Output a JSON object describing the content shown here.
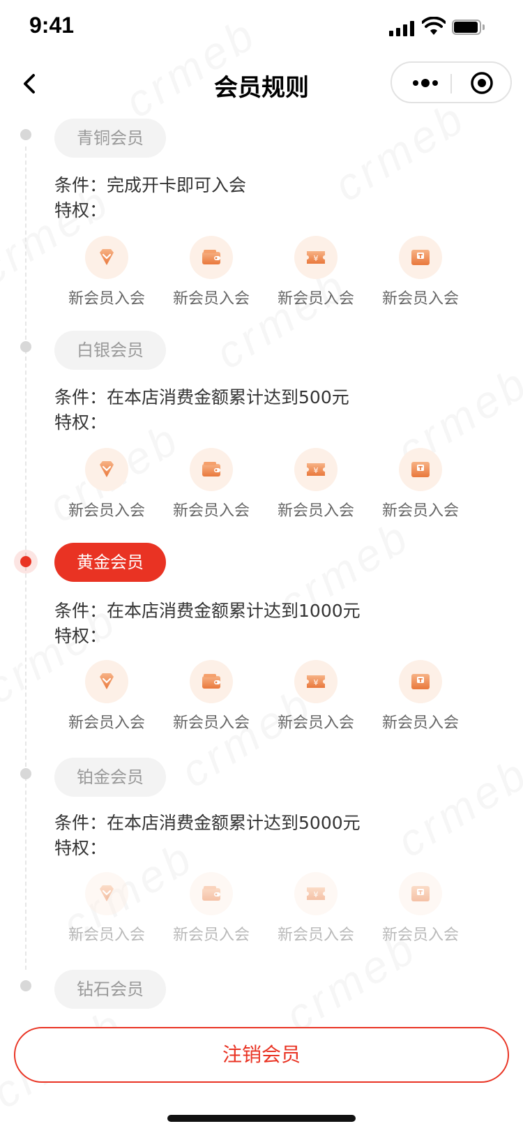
{
  "status_bar": {
    "time": "9:41"
  },
  "nav": {
    "title": "会员规则",
    "back_icon": "chevron-left-icon",
    "more_icon": "more-dots-icon",
    "close_icon": "target-circle-icon"
  },
  "levels": [
    {
      "name": "青铜会员",
      "active": false,
      "condition": "条件：完成开卡即可入会",
      "privilege_label": "特权：",
      "benefits": [
        {
          "label": "新会员入会",
          "icon": "diamond-icon"
        },
        {
          "label": "新会员入会",
          "icon": "wallet-icon"
        },
        {
          "label": "新会员入会",
          "icon": "coupon-icon"
        },
        {
          "label": "新会员入会",
          "icon": "gift-card-icon"
        }
      ]
    },
    {
      "name": "白银会员",
      "active": false,
      "condition": "条件：在本店消费金额累计达到500元",
      "privilege_label": "特权：",
      "benefits": [
        {
          "label": "新会员入会",
          "icon": "diamond-icon"
        },
        {
          "label": "新会员入会",
          "icon": "wallet-icon"
        },
        {
          "label": "新会员入会",
          "icon": "coupon-icon"
        },
        {
          "label": "新会员入会",
          "icon": "gift-card-icon"
        }
      ]
    },
    {
      "name": "黄金会员",
      "active": true,
      "condition": "条件：在本店消费金额累计达到1000元",
      "privilege_label": "特权：",
      "benefits": [
        {
          "label": "新会员入会",
          "icon": "diamond-icon"
        },
        {
          "label": "新会员入会",
          "icon": "wallet-icon"
        },
        {
          "label": "新会员入会",
          "icon": "coupon-icon"
        },
        {
          "label": "新会员入会",
          "icon": "gift-card-icon"
        }
      ]
    },
    {
      "name": "铂金会员",
      "active": false,
      "condition": "条件：在本店消费金额累计达到5000元",
      "privilege_label": "特权：",
      "benefits": [
        {
          "label": "新会员入会",
          "icon": "diamond-icon"
        },
        {
          "label": "新会员入会",
          "icon": "wallet-icon"
        },
        {
          "label": "新会员入会",
          "icon": "coupon-icon"
        },
        {
          "label": "新会员入会",
          "icon": "gift-card-icon"
        }
      ]
    },
    {
      "name": "钻石会员",
      "active": false
    }
  ],
  "footer": {
    "cancel_label": "注销会员"
  },
  "colors": {
    "accent": "#e93323",
    "icon_bg": "#fdf0e7",
    "icon_gradient_start": "#f7b285",
    "icon_gradient_end": "#e9783c"
  }
}
